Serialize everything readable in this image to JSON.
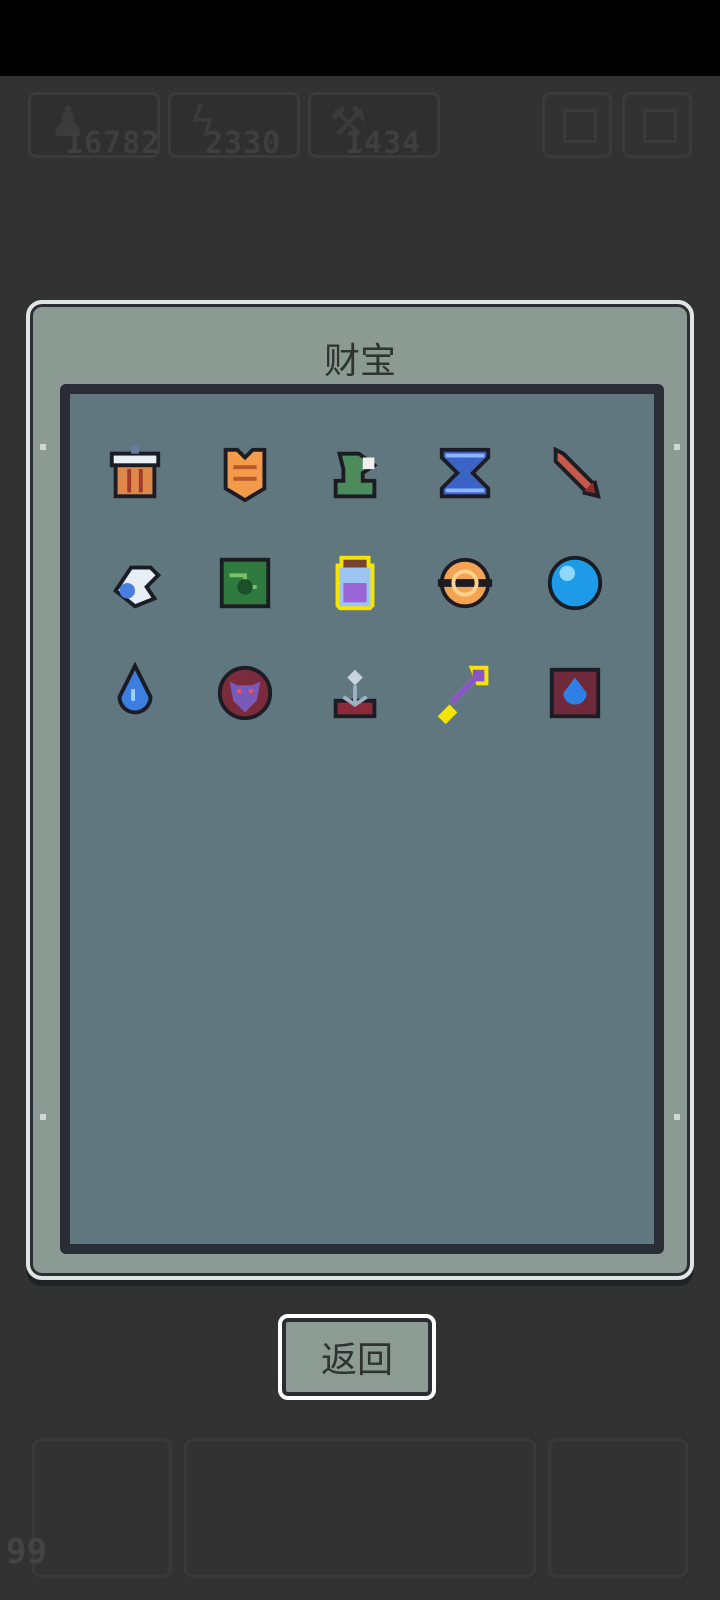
{
  "hud": {
    "stats": [
      {
        "icon": "runner-icon",
        "value": "16782"
      },
      {
        "icon": "lightning-icon",
        "value": "2330"
      },
      {
        "icon": "pickaxe-icon",
        "value": "1434"
      }
    ],
    "level": "99"
  },
  "panel": {
    "title": "财宝",
    "items": [
      {
        "icon": "drum-icon"
      },
      {
        "icon": "orange-armor-icon"
      },
      {
        "icon": "green-hood-icon"
      },
      {
        "icon": "hourglass-icon"
      },
      {
        "icon": "arrow-icon"
      },
      {
        "icon": "winged-helmet-icon"
      },
      {
        "icon": "green-map-icon"
      },
      {
        "icon": "potion-jar-icon",
        "selected": true
      },
      {
        "icon": "ring-orb-icon"
      },
      {
        "icon": "blue-orb-icon"
      },
      {
        "icon": "water-drop-icon"
      },
      {
        "icon": "demon-shield-icon"
      },
      {
        "icon": "anchor-altar-icon"
      },
      {
        "icon": "purple-key-icon",
        "selected": true
      },
      {
        "icon": "blue-flame-tome-icon"
      }
    ]
  },
  "back_label": "返回",
  "colors": {
    "selected_outline": "#f5e400",
    "panel": "#8c9a94",
    "inner": "#607780"
  }
}
